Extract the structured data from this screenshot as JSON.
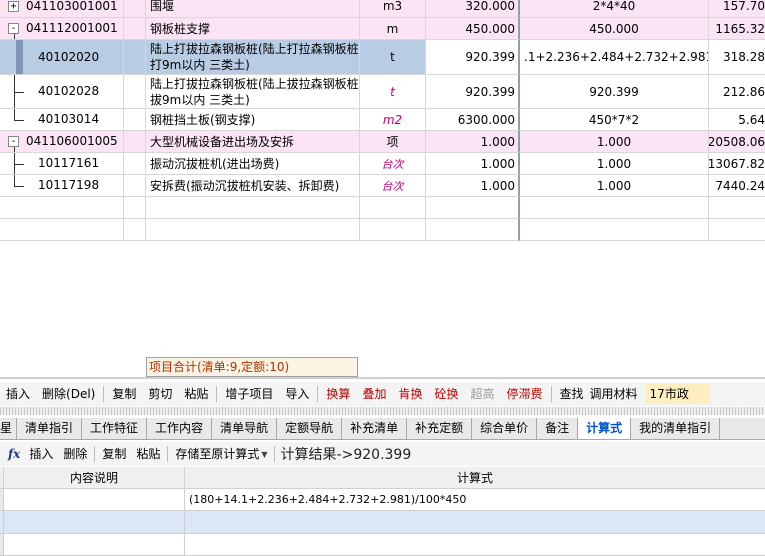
{
  "grid": {
    "rows": [
      {
        "code": "041103001001",
        "name": "围堰",
        "unit": "m3",
        "qty": "320.000",
        "expr": "2*4*40",
        "price": "157.70"
      },
      {
        "code": "041112001001",
        "name": "钢板桩支撑",
        "unit": "m",
        "qty": "450.000",
        "expr": "450.000",
        "price": "1165.32"
      },
      {
        "code": "40102020",
        "name": "陆上打拔拉森钢板桩(陆上打拉森钢板桩 打9m以内 三类土)",
        "unit": "t",
        "qty": "920.399",
        "expr": ".1+2.236+2.484+2.732+2.981)/",
        "price": "318.28"
      },
      {
        "code": "40102028",
        "name": "陆上打拔拉森钢板桩(陆上拔拉森钢板桩 拔9m以内 三类土)",
        "unit": "t",
        "qty": "920.399",
        "expr": "920.399",
        "price": "212.86"
      },
      {
        "code": "40103014",
        "name": "钢桩挡土板(钢支撑)",
        "unit": "m2",
        "qty": "6300.000",
        "expr": "450*7*2",
        "price": "5.64"
      },
      {
        "code": "041106001005",
        "name": "大型机械设备进出场及安拆",
        "unit": "项",
        "qty": "1.000",
        "expr": "1.000",
        "price": "20508.06"
      },
      {
        "code": "10117161",
        "name": "振动沉拔桩机(进出场费)",
        "unit": "台次",
        "qty": "1.000",
        "expr": "1.000",
        "price": "13067.82"
      },
      {
        "code": "10117198",
        "name": "安拆费(振动沉拔桩机安装、拆卸费)",
        "unit": "台次",
        "qty": "1.000",
        "expr": "1.000",
        "price": "7440.24"
      }
    ],
    "expand_plus": "+",
    "expand_minus": "-"
  },
  "summary": "项目合计(清单:9,定额:10)",
  "toolbar": {
    "insert": "插入",
    "delete": "删除(Del)",
    "copy": "复制",
    "cut": "剪切",
    "paste": "粘贴",
    "add_sub": "增子项目",
    "import": "导入",
    "replace_calc": "换算",
    "stack": "叠加",
    "fat_replace": "肯换",
    "concrete_replace": "砼换",
    "super_height": "超高",
    "stall_fee": "停滞费",
    "find": "查找",
    "use_material": "调用材料",
    "material_field": "17市政"
  },
  "tabs": [
    "星",
    "清单指引",
    "工作特征",
    "工作内容",
    "清单导航",
    "定额导航",
    "补充清单",
    "补充定额",
    "综合单价",
    "备注",
    "计算式",
    "我的清单指引"
  ],
  "active_tab": "计算式",
  "calc_toolbar": {
    "fx_label": "fx",
    "insert": "插入",
    "delete": "删除",
    "copy": "复制",
    "paste": "粘贴",
    "save_to_formula": "存储至原计算式",
    "dropdown_arrow": "▼",
    "result": "计算结果->920.399"
  },
  "detail": {
    "header_desc": "内容说明",
    "header_formula": "计算式",
    "row1_formula": "(180+14.1+2.236+2.484+2.732+2.981)/100*450"
  }
}
